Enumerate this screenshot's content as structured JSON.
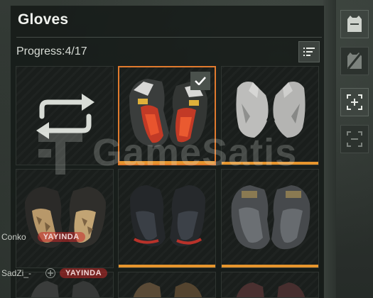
{
  "panel": {
    "title": "Gloves",
    "progress_label": "Progress:4/17"
  },
  "tiles": [
    {
      "name": "random-option",
      "selected": false,
      "rarity": false
    },
    {
      "name": "red-white-gloves",
      "selected": true,
      "rarity": true
    },
    {
      "name": "bare-hands",
      "selected": false,
      "rarity": true
    },
    {
      "name": "tan-camo-gloves",
      "selected": false,
      "rarity": false
    },
    {
      "name": "dark-red-gloves",
      "selected": false,
      "rarity": true
    },
    {
      "name": "grey-tactical-gloves",
      "selected": false,
      "rarity": true
    }
  ],
  "sidebar": {
    "icons": [
      "vest-icon",
      "vest-crossed-icon",
      "expand-icon",
      "collapse-icon"
    ]
  },
  "watermark": {
    "text": "GameSatis"
  },
  "stream_overlay": [
    {
      "user": "Conko",
      "badge": "YAYINDA"
    },
    {
      "user": "SadZi_-",
      "badge": "YAYINDA"
    }
  ],
  "colors": {
    "selection": "#e07a2e",
    "rarity": "#e6952d",
    "panel_bg": "#14181680"
  }
}
